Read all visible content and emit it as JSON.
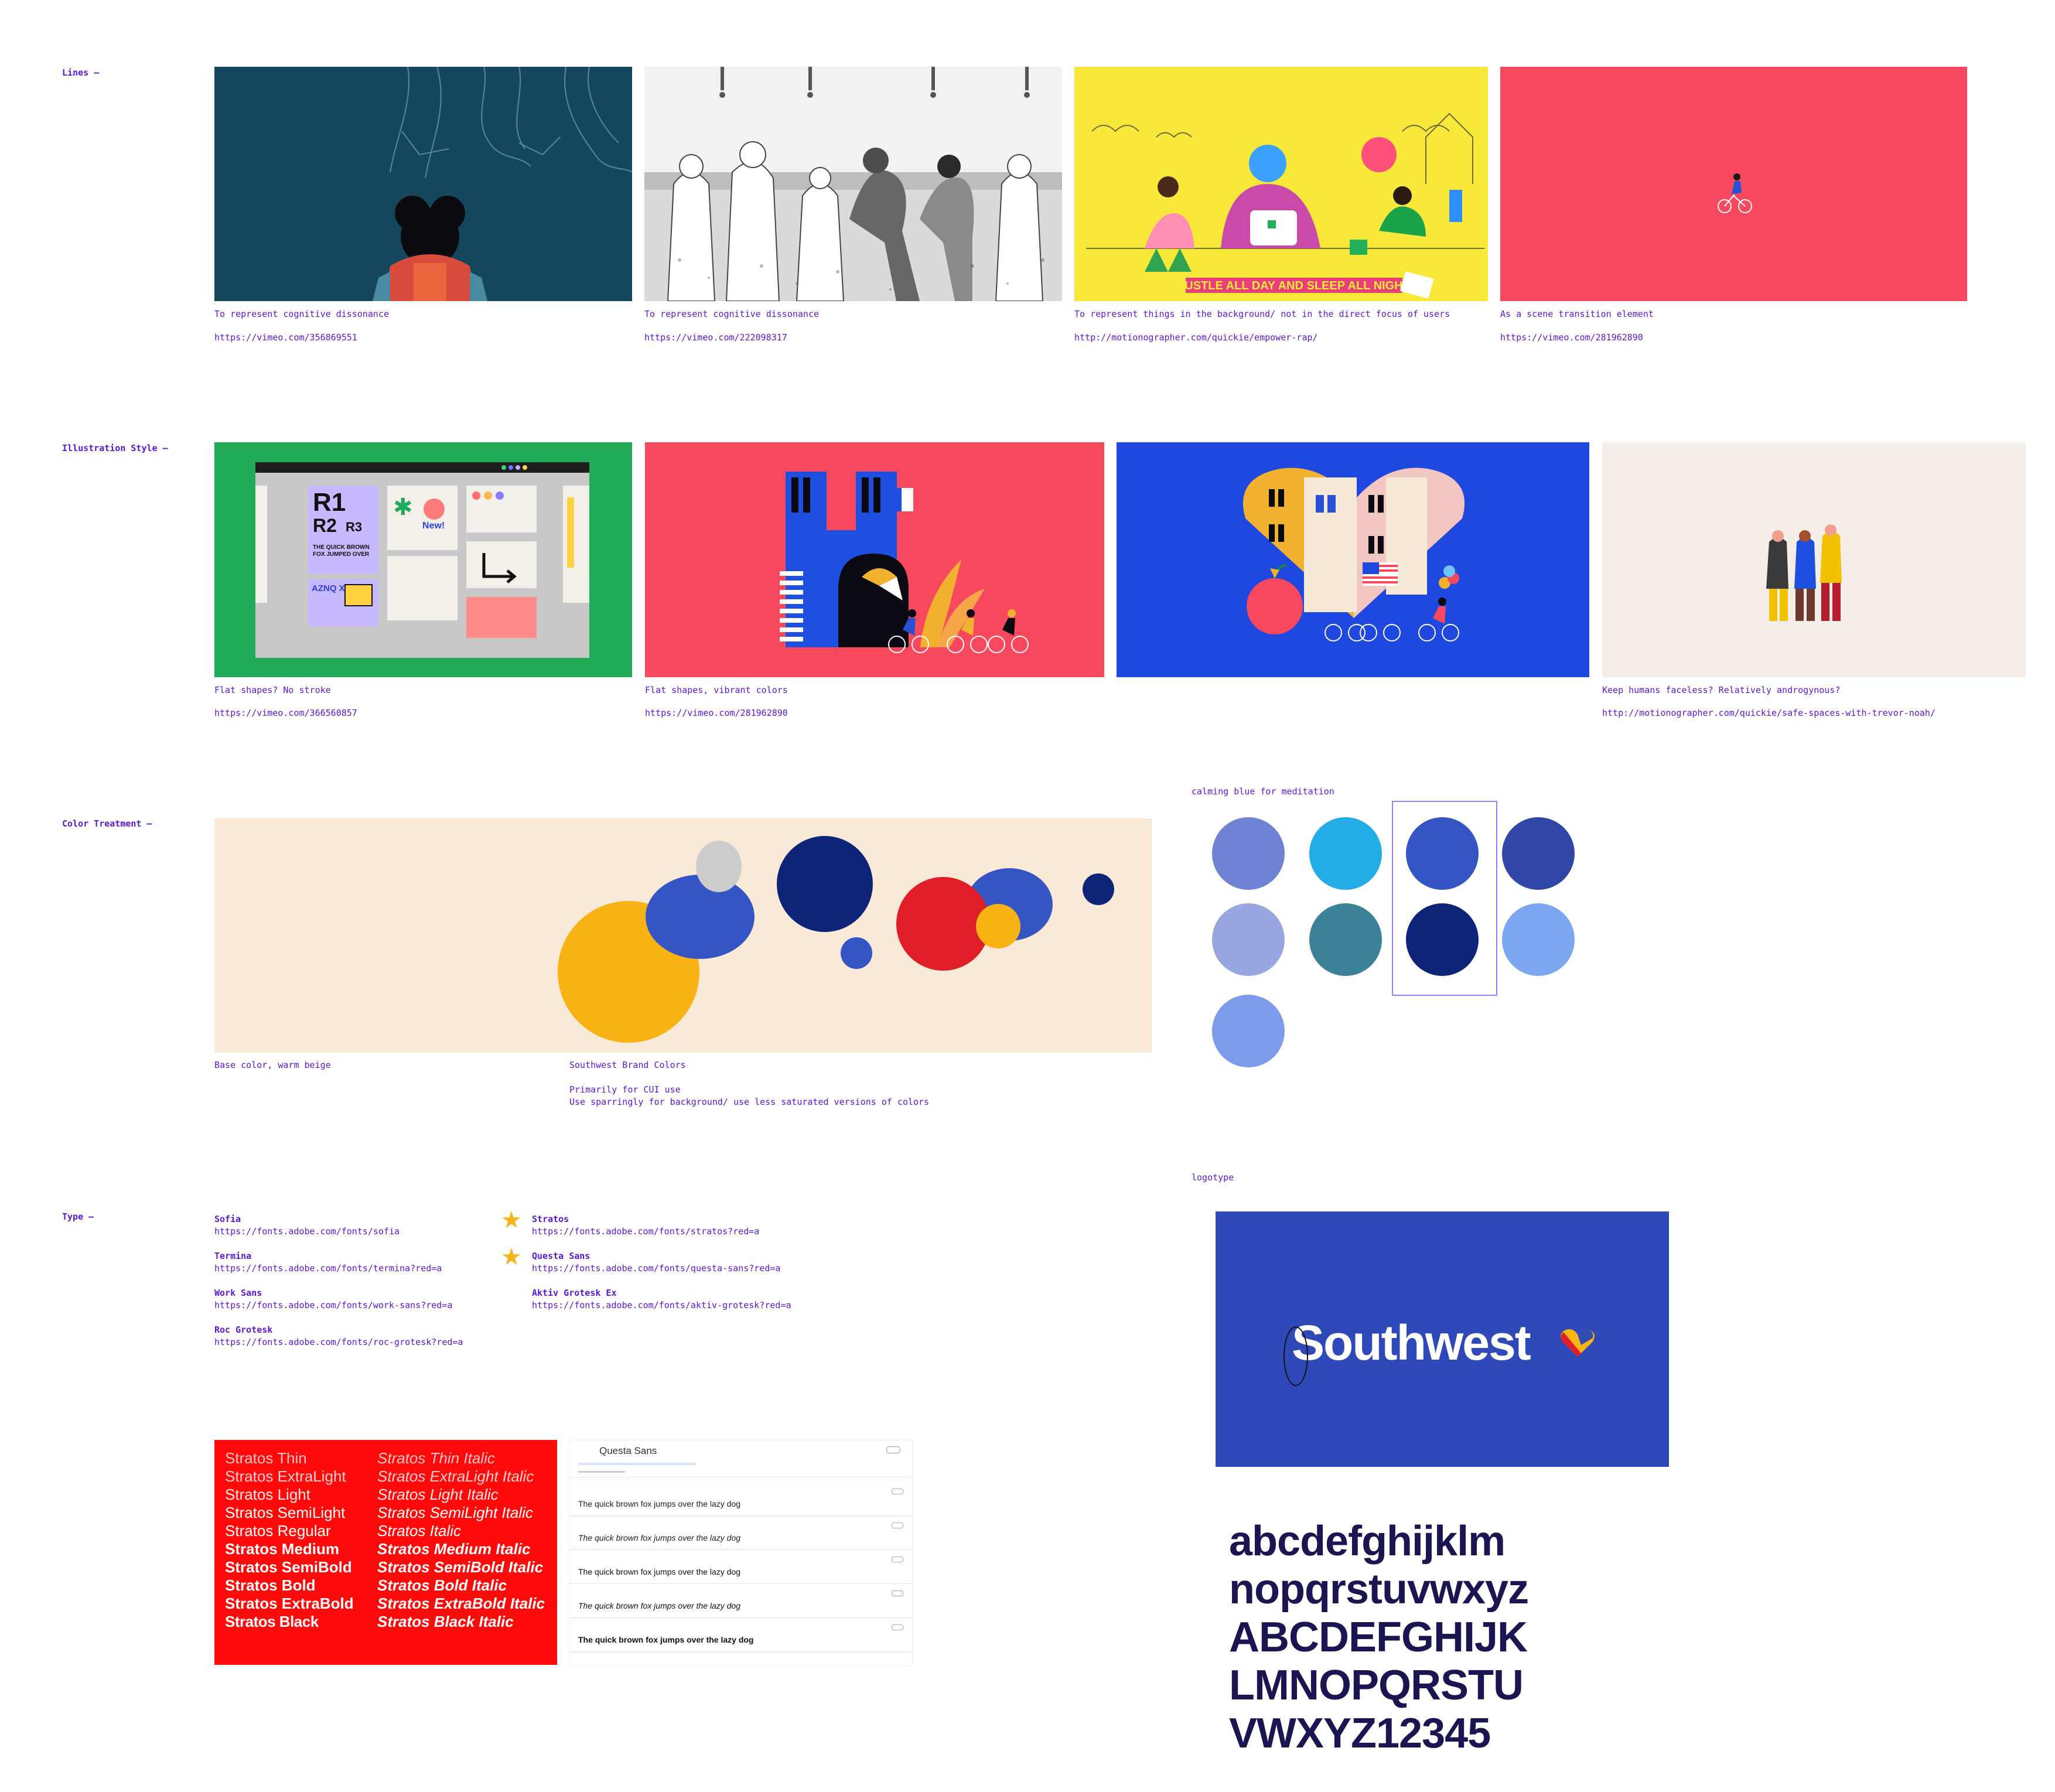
{
  "sections": {
    "lines": "Lines —",
    "illustration": "Illustration Style —",
    "color": "Color Treatment —",
    "type": "Type —"
  },
  "lines_row": [
    {
      "caption": "To represent cognitive dissonance",
      "url": "https://vimeo.com/356869551"
    },
    {
      "caption": "To represent cognitive dissonance",
      "url": "https://vimeo.com/222098317"
    },
    {
      "caption": "To represent things in the background/ not in the direct focus of users",
      "url": "http://motionographer.com/quickie/empower-rap/",
      "banner": "HUSTLE ALL DAY AND SLEEP ALL NIGHT."
    },
    {
      "caption": "As a scene transition element",
      "url": "https://vimeo.com/281962890"
    }
  ],
  "illustration_row": [
    {
      "caption": "Flat shapes? No stroke",
      "url": "https://vimeo.com/366560857",
      "screen": {
        "r1": "R1",
        "r2": "R2",
        "r3": "R3",
        "new": "New!",
        "quick": "THE QUICK BROWN FOX JUMPED OVER",
        "azn": "AZNQ XBR"
      }
    },
    {
      "caption": "Flat shapes, vibrant colors",
      "url": "https://vimeo.com/281962890"
    },
    {
      "caption": "",
      "url": ""
    },
    {
      "caption": "Keep humans faceless? Relatively androgynous?",
      "url": "http://motionographer.com/quickie/safe-spaces-with-trevor-noah/"
    }
  ],
  "color_treatment": {
    "base_caption": "Base color, warm beige",
    "brand_title": "Southwest Brand Colors",
    "brand_line1": "Primarily for CUI use",
    "brand_line2": "Use sparringly for background/ use less saturated versions of colors",
    "beige": "#f9ead8",
    "palette_label": "calming blue for meditation",
    "palette": [
      "#6f82d3",
      "#22ade6",
      "#3555c4",
      "#3047a8",
      "#98a7e0",
      "#3b8299",
      "#0e2478",
      "#7aa7f0",
      "#7c9bea"
    ]
  },
  "type": {
    "left_fonts": [
      {
        "name": "Sofia",
        "url": "https://fonts.adobe.com/fonts/sofia"
      },
      {
        "name": "Termina",
        "url": "https://fonts.adobe.com/fonts/termina?red=a"
      },
      {
        "name": "Work Sans",
        "url": "https://fonts.adobe.com/fonts/work-sans?red=a"
      },
      {
        "name": "Roc Grotesk",
        "url": "https://fonts.adobe.com/fonts/roc-grotesk?red=a"
      }
    ],
    "right_fonts": [
      {
        "name": "Stratos",
        "url": "https://fonts.adobe.com/fonts/stratos?red=a",
        "starred": true
      },
      {
        "name": "Questa Sans",
        "url": "https://fonts.adobe.com/fonts/questa-sans?red=a",
        "starred": true
      },
      {
        "name": "Aktiv Grotesk Ex",
        "url": "https://fonts.adobe.com/fonts/aktiv-grotesk?red=a",
        "starred": false
      }
    ],
    "stratos_upright": [
      "Stratos Thin",
      "Stratos ExtraLight",
      "Stratos Light",
      "Stratos SemiLight",
      "Stratos Regular",
      "Stratos Medium",
      "Stratos SemiBold",
      "Stratos Bold",
      "Stratos ExtraBold",
      "Stratos Black"
    ],
    "stratos_italic": [
      "Stratos Thin Italic",
      "Stratos ExtraLight Italic",
      "Stratos Light Italic",
      "Stratos SemiLight Italic",
      "Stratos Italic",
      "Stratos Medium Italic",
      "Stratos SemiBold Italic",
      "Stratos Bold Italic",
      "Stratos ExtraBold Italic",
      "Stratos Black Italic"
    ],
    "questa": {
      "title": "Questa Sans",
      "pangram": "The quick brown fox jumps over the lazy dog"
    }
  },
  "logotype": {
    "label": "logotype",
    "brand": "Southwest",
    "bg": "#3049b8",
    "alphabet": [
      "abcdefghijklm",
      "nopqrstuvwxyz",
      "ABCDEFGHIJK",
      "LMNOPQRSTU",
      "VWXYZ12345"
    ]
  }
}
